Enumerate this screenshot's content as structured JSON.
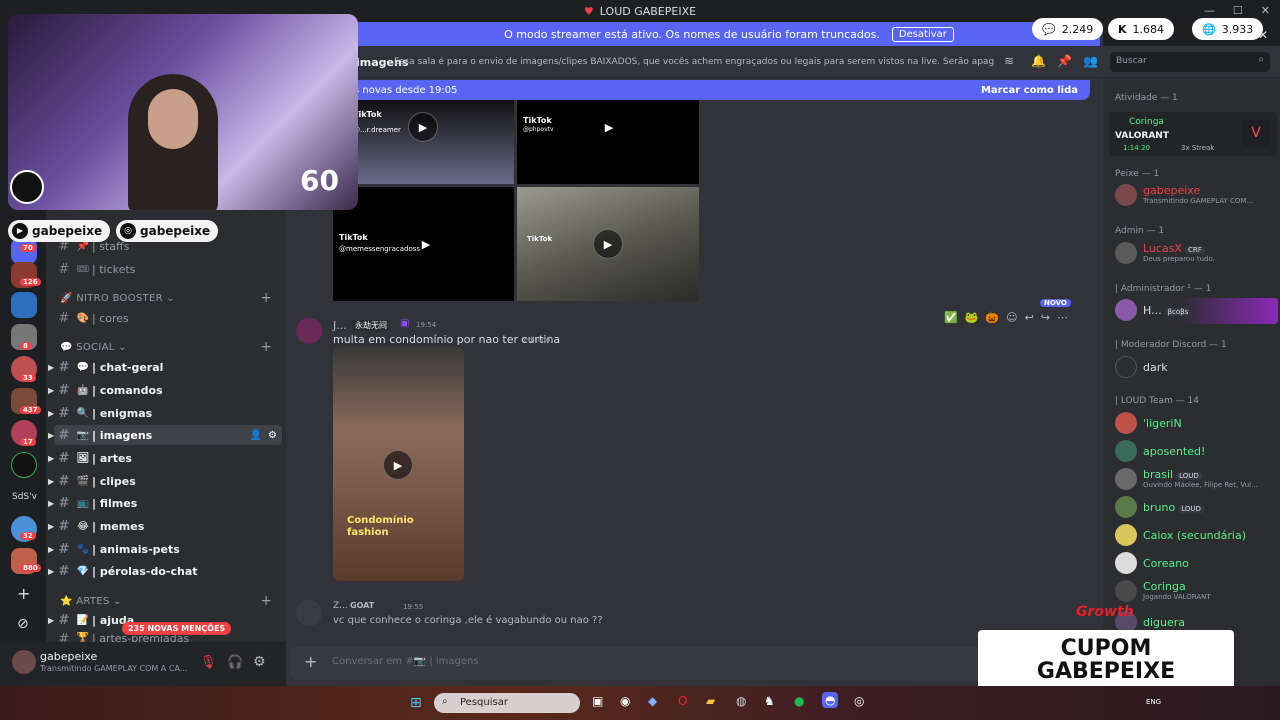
{
  "titlebar": {
    "title": "LOUD GABEPEIXE",
    "controls": [
      "—",
      "☐",
      "✕"
    ]
  },
  "streamer_bar": {
    "message": "O modo streamer está ativo. Os nomes de usuário foram truncados.",
    "button": "Desativar"
  },
  "stats": [
    {
      "icon": "chat-icon",
      "value": "2.249"
    },
    {
      "icon": "kick-icon",
      "value": "1.684"
    },
    {
      "icon": "globe-icon",
      "value": "3.933"
    }
  ],
  "topbar": {
    "channel_name": "imagens",
    "topic": "Essa sala é para o envio de imagens/clipes BAIXADOS, que vocês achem engraçados ou legais para serem vistos na live. Serão apagados prints de ou...",
    "search_placeholder": "Buscar"
  },
  "new_messages_bar": {
    "text": "s novas desde 19:05",
    "action": "Marcar como lida"
  },
  "webcam": {
    "counter": "60",
    "youtube_handle": "gabepeixe",
    "instagram_handle": "gabepeixe"
  },
  "guilds": [
    {
      "badge": "70"
    },
    {
      "badge": "126"
    },
    {
      "badge": ""
    },
    {
      "badge": "8"
    },
    {
      "badge": "33"
    },
    {
      "badge": "437"
    },
    {
      "badge": "17"
    },
    {
      "badge": ""
    },
    {
      "badge": "SdS'v"
    },
    {
      "badge": "32"
    },
    {
      "badge": "880"
    }
  ],
  "channels": {
    "top_items": [
      {
        "emoji": "📌",
        "label": "| staffs"
      },
      {
        "emoji": "🎟",
        "label": "| tickets"
      }
    ],
    "nitro_category": "NITRO BOOSTER",
    "nitro_items": [
      {
        "emoji": "🎨",
        "label": "| cores"
      }
    ],
    "social_category": "SOCIAL",
    "social_items": [
      {
        "emoji": "💬",
        "label": "| chat-geral",
        "state": "bright"
      },
      {
        "emoji": "🤖",
        "label": "| comandos",
        "state": "bright"
      },
      {
        "emoji": "🔍",
        "label": "| enigmas",
        "state": "bright"
      },
      {
        "emoji": "📷",
        "label": "| imagens",
        "state": "active"
      },
      {
        "emoji": "🖼",
        "label": "| artes",
        "state": "bright"
      },
      {
        "emoji": "🎬",
        "label": "| clipes",
        "state": "bright"
      },
      {
        "emoji": "📺",
        "label": "| filmes",
        "state": "bright"
      },
      {
        "emoji": "😂",
        "label": "| memes",
        "state": "bright"
      },
      {
        "emoji": "🐾",
        "label": "| animais-pets",
        "state": "bright"
      },
      {
        "emoji": "💎",
        "label": "| pérolas-do-chat",
        "state": "bright"
      }
    ],
    "artes_category": "ARTES",
    "artes_items": [
      {
        "emoji": "📝",
        "label": "| ajuda"
      },
      {
        "emoji": "🏆",
        "label": "| artes-premiadas"
      }
    ],
    "mentions_badge": "235 NOVAS MENÇÕES"
  },
  "user_panel": {
    "name": "gabepeixe",
    "status": "Transmitindo GAMEPLAY COM A CA..."
  },
  "videos_top": [
    {
      "brand": "TikTok",
      "handle": "@...r.dreamer"
    },
    {
      "brand": "TikTok",
      "handle": "@phpovtv"
    },
    {
      "brand": "TikTok",
      "handle": "@memessengracadoss"
    },
    {
      "brand": "TikTok",
      "handle": ""
    }
  ],
  "message1": {
    "author": "J...",
    "tag": "永劫无间",
    "time": "19:54",
    "text": "multa em condomínio por nao ter curtina",
    "edited": "(editado)",
    "video_caption": "Condomínio fashion",
    "new_badge": "NOVO"
  },
  "message2": {
    "author": "Z...",
    "tag": "GOAT",
    "time": "19:55",
    "text": "vc que conhece o coringa ,ele é vagabundo ou nao ??"
  },
  "composer": {
    "placeholder": "Conversar em #📷 | imagens"
  },
  "members": {
    "activity_header": "Atividade — 1",
    "activity": {
      "name": "Coringa",
      "game": "VALORANT",
      "time": "1:14:20",
      "streak": "3x Streak"
    },
    "groups": [
      {
        "header": "Peixe — 1",
        "items": [
          {
            "name": "gabepeixe",
            "sub": "Transmitindo GAMEPLAY COM...",
            "color": "#ed4245"
          }
        ]
      },
      {
        "header": "Admin — 1",
        "items": [
          {
            "name": "LucasX",
            "tag": "CRF",
            "sub": "Deus preparou tudo.",
            "color": "#ed4245"
          }
        ]
      },
      {
        "header": "| Administrador ² — 1",
        "items": [
          {
            "name": "H...",
            "tag": "βcoβs",
            "sub": "",
            "color": "#f2f3f5"
          }
        ]
      },
      {
        "header": "| Moderador Discord — 1",
        "items": [
          {
            "name": "dark",
            "sub": "",
            "color": "#f2f3f5"
          }
        ]
      },
      {
        "header": "| LOUD Team — 14",
        "items": [
          {
            "name": "'ligeriN",
            "sub": "",
            "color": "#57f287"
          },
          {
            "name": "aposented!",
            "sub": "",
            "color": "#57f287"
          },
          {
            "name": "brasil",
            "tag": "LOUD",
            "sub": "Ouvindo Máolee, Filipe Ret, Vul...",
            "color": "#57f287"
          },
          {
            "name": "bruno",
            "tag": "LOUD",
            "sub": "",
            "color": "#57f287"
          },
          {
            "name": "Caiox (secundária)",
            "sub": "",
            "color": "#57f287"
          },
          {
            "name": "Coreano",
            "sub": "",
            "color": "#57f287"
          },
          {
            "name": "Coringa",
            "sub": "Jogando VALORANT",
            "color": "#57f287"
          },
          {
            "name": "diguera",
            "sub": "",
            "color": "#57f287"
          }
        ]
      }
    ]
  },
  "overlay": {
    "coupon_line1": "CUPOM",
    "coupon_line2": "GABEPEIXE",
    "growth": "Growth"
  },
  "taskbar": {
    "search_placeholder": "Pesquisar",
    "tray": "ENG"
  }
}
